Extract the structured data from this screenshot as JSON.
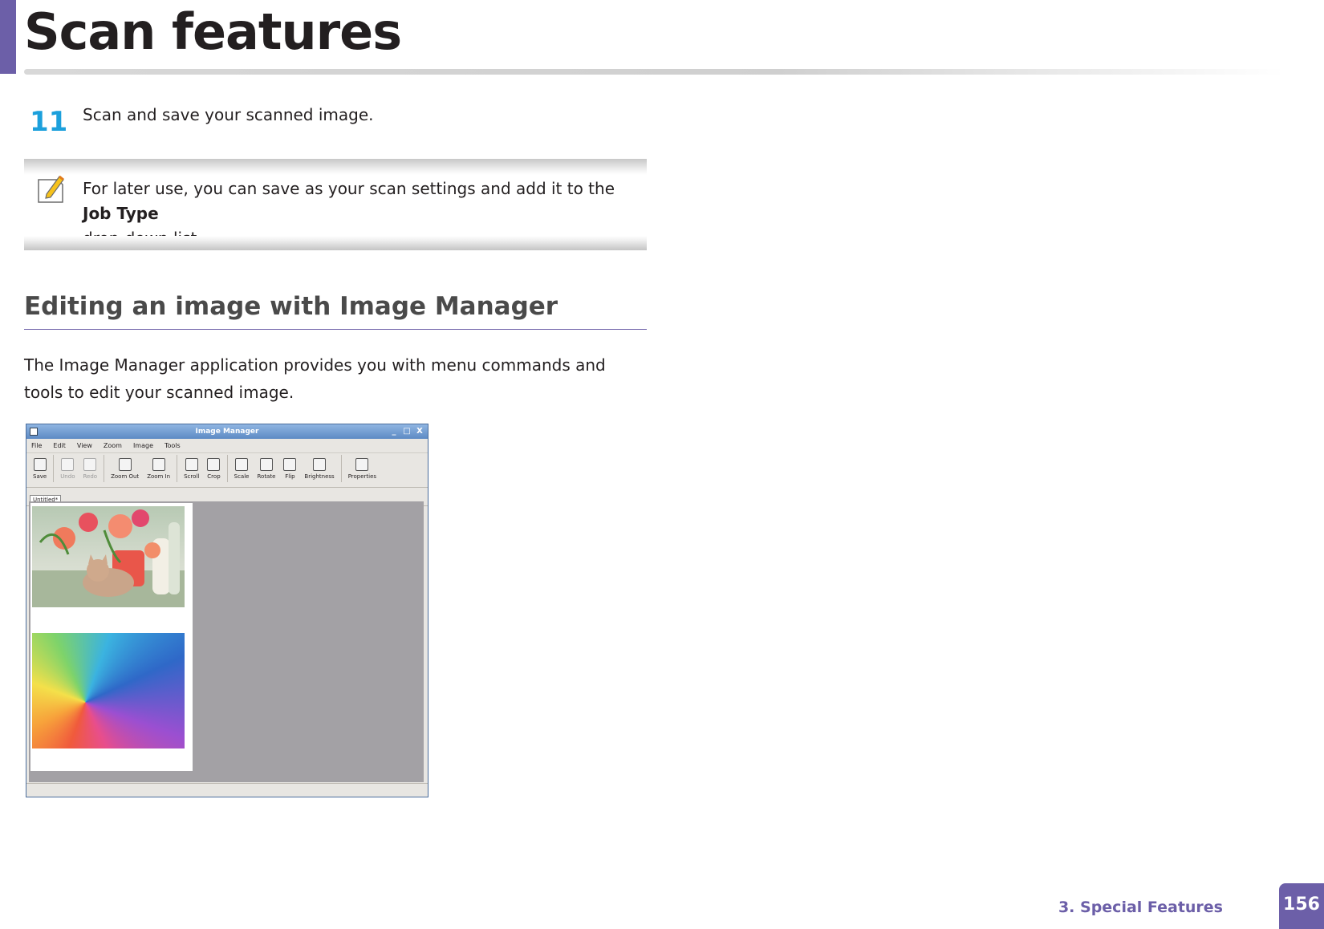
{
  "header": {
    "title": "Scan features"
  },
  "step": {
    "number": "11",
    "text": "Scan and save your scanned image."
  },
  "note": {
    "text_before": "For later use, you can save as your scan settings and add it to the ",
    "bold": "Job Type",
    "text_after": "drop-down list."
  },
  "section": {
    "heading": "Editing an image with Image Manager",
    "body": "The Image Manager application provides you with menu commands and tools to edit your scanned image."
  },
  "app": {
    "title": "Image Manager",
    "window_controls": [
      "_",
      "□",
      "X"
    ],
    "menu": [
      "File",
      "Edit",
      "View",
      "Zoom",
      "Image",
      "Tools"
    ],
    "toolbar": [
      {
        "label": "Save",
        "icon": "save-icon",
        "enabled": true
      },
      {
        "label": "Undo",
        "icon": "undo-icon",
        "enabled": false
      },
      {
        "label": "Redo",
        "icon": "redo-icon",
        "enabled": false
      },
      {
        "label": "Zoom Out",
        "icon": "zoom-out-icon",
        "enabled": true
      },
      {
        "label": "Zoom In",
        "icon": "zoom-in-icon",
        "enabled": true
      },
      {
        "label": "Scroll",
        "icon": "scroll-icon",
        "enabled": true
      },
      {
        "label": "Crop",
        "icon": "crop-icon",
        "enabled": true
      },
      {
        "label": "Scale",
        "icon": "scale-icon",
        "enabled": true
      },
      {
        "label": "Rotate",
        "icon": "rotate-icon",
        "enabled": true
      },
      {
        "label": "Flip",
        "icon": "flip-icon",
        "enabled": true
      },
      {
        "label": "Brightness",
        "icon": "brightness-icon",
        "enabled": true
      },
      {
        "label": "Properties",
        "icon": "properties-icon",
        "enabled": true
      }
    ],
    "tab": "Untitled*"
  },
  "footer": {
    "chapter": "3.  Special Features",
    "page": "156"
  },
  "colors": {
    "accent": "#6c5fa8",
    "step_number": "#1ca0dc"
  }
}
